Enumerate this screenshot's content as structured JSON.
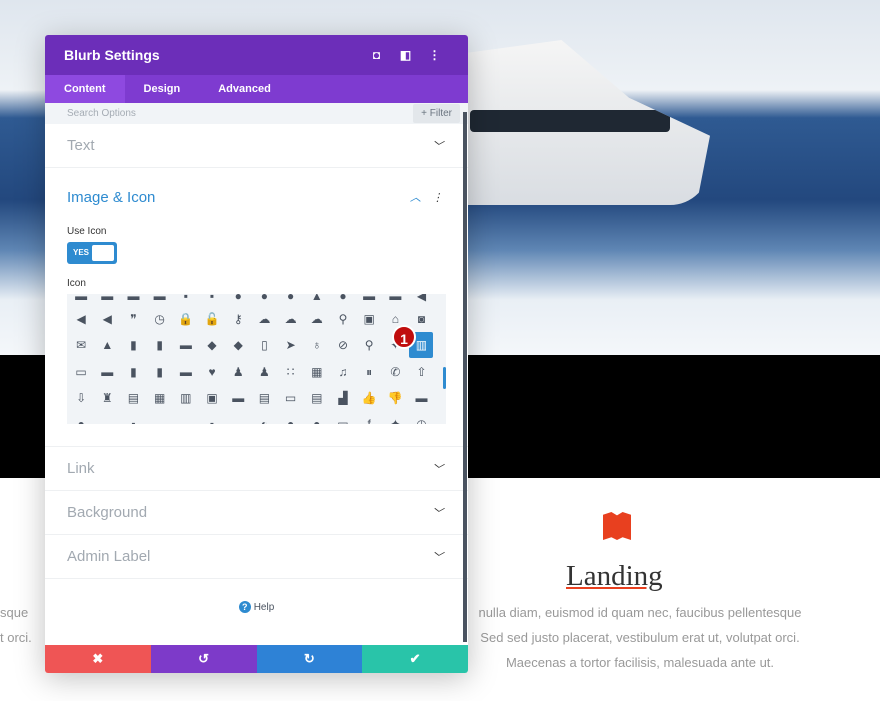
{
  "panel": {
    "title": "Blurb Settings",
    "header_icons": [
      "expand-icon",
      "split-view-icon",
      "more-icon"
    ],
    "tabs": [
      "Content",
      "Design",
      "Advanced"
    ],
    "search_placeholder": "Search Options",
    "filter_label": "+ Filter",
    "sections": {
      "text": "Text",
      "image_icon": "Image & Icon",
      "link": "Link",
      "background": "Background",
      "admin_label": "Admin Label"
    },
    "use_icon_label": "Use Icon",
    "toggle_value": "YES",
    "icon_label": "Icon",
    "icon_rows": [
      [
        "▬",
        "▬",
        "▬",
        "▬",
        "▪",
        "▪",
        "●",
        "●",
        "●",
        "▲",
        "●",
        "▬",
        "▬",
        "◀"
      ],
      [
        "◀",
        "◀",
        "❞",
        "◷",
        "🔒",
        "🔓",
        "⚷",
        "☁",
        "☁",
        "☁",
        "⚲",
        "▣",
        "⌂",
        "◙"
      ],
      [
        "✉",
        "▲",
        "▮",
        "▮",
        "▬",
        "◆",
        "◆",
        "▯",
        "➤",
        "♁",
        "⊘",
        "⚲",
        "✦",
        "▥"
      ],
      [
        "▭",
        "▬",
        "▮",
        "▮",
        "▬",
        "♥",
        "♟",
        "♟",
        "∷",
        "▦",
        "♫",
        "⏸",
        "✆",
        "⇧"
      ],
      [
        "⇩",
        "♜",
        "▤",
        "▦",
        "▥",
        "▣",
        "▬",
        "▤",
        "▭",
        "▤",
        "▟",
        "👍",
        "👎",
        "▬"
      ],
      [
        "●",
        "▬",
        "▪",
        "▬",
        "▬",
        "▪",
        "▬",
        "◐",
        "●",
        "●",
        "▭",
        "f",
        "✦",
        "◷"
      ]
    ],
    "badge": "1",
    "help": "Help",
    "footer": {
      "discard": "✖",
      "undo": "↺",
      "redo": "↻",
      "save": "✔"
    },
    "colors": {
      "header": "#6c2eb9",
      "tabs": "#7e3bd0",
      "discard": "#ef5555",
      "undo": "#7d3ac9",
      "redo": "#2e82d6",
      "save": "#29c4a9"
    }
  },
  "page": {
    "blurb_title": "Landing",
    "blurb_text": [
      "nulla diam, euismod id quam nec, faucibus pellentesque",
      "Sed sed justo placerat, vestibulum erat ut, volutpat orci.",
      "Maecenas a tortor facilisis, malesuada ante ut."
    ],
    "left_text": [
      "sque",
      "t orci."
    ]
  }
}
